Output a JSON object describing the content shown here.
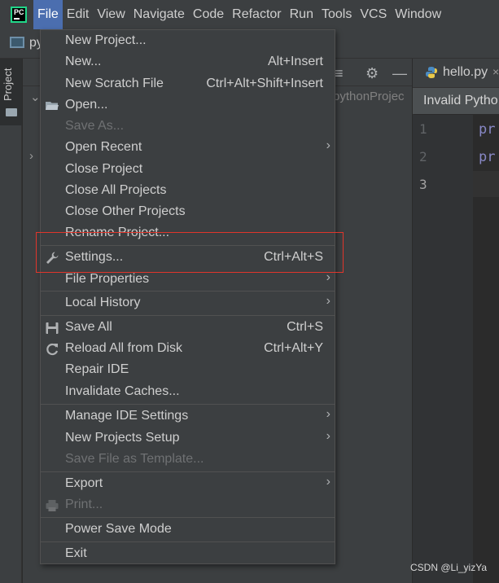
{
  "menubar": {
    "logo_text": "PC",
    "items": [
      "File",
      "Edit",
      "View",
      "Navigate",
      "Code",
      "Refactor",
      "Run",
      "Tools",
      "VCS",
      "Window"
    ],
    "active": "File"
  },
  "navbar": {
    "project_short": "py"
  },
  "stripe": {
    "project_label": "Project"
  },
  "project_panel": {
    "path_fragment": "pythonProjec"
  },
  "editor": {
    "tab_label": "hello.py",
    "notification": "Invalid Pytho",
    "line_numbers": [
      "1",
      "2",
      "3"
    ],
    "code_lines": [
      "pr",
      "pr"
    ]
  },
  "file_menu": {
    "items": [
      {
        "label": "New Project...",
        "shortcut": "",
        "disabled": false,
        "submenu": false,
        "icon": ""
      },
      {
        "label": "New...",
        "shortcut": "Alt+Insert",
        "disabled": false,
        "submenu": false,
        "icon": ""
      },
      {
        "label": "New Scratch File",
        "shortcut": "Ctrl+Alt+Shift+Insert",
        "disabled": false,
        "submenu": false,
        "icon": ""
      },
      {
        "label": "Open...",
        "shortcut": "",
        "disabled": false,
        "submenu": false,
        "icon": "folder-icon"
      },
      {
        "label": "Save As...",
        "shortcut": "",
        "disabled": true,
        "submenu": false,
        "icon": ""
      },
      {
        "label": "Open Recent",
        "shortcut": "",
        "disabled": false,
        "submenu": true,
        "icon": ""
      },
      {
        "label": "Close Project",
        "shortcut": "",
        "disabled": false,
        "submenu": false,
        "icon": ""
      },
      {
        "label": "Close All Projects",
        "shortcut": "",
        "disabled": false,
        "submenu": false,
        "icon": ""
      },
      {
        "label": "Close Other Projects",
        "shortcut": "",
        "disabled": false,
        "submenu": false,
        "icon": ""
      },
      {
        "label": "Rename Project...",
        "shortcut": "",
        "disabled": false,
        "submenu": false,
        "icon": ""
      },
      {
        "label": "Settings...",
        "shortcut": "Ctrl+Alt+S",
        "disabled": false,
        "submenu": false,
        "icon": "wrench-icon"
      },
      {
        "label": "File Properties",
        "shortcut": "",
        "disabled": false,
        "submenu": true,
        "icon": ""
      },
      {
        "label": "Local History",
        "shortcut": "",
        "disabled": false,
        "submenu": true,
        "icon": ""
      },
      {
        "label": "Save All",
        "shortcut": "Ctrl+S",
        "disabled": false,
        "submenu": false,
        "icon": "save-icon"
      },
      {
        "label": "Reload All from Disk",
        "shortcut": "Ctrl+Alt+Y",
        "disabled": false,
        "submenu": false,
        "icon": "reload-icon"
      },
      {
        "label": "Repair IDE",
        "shortcut": "",
        "disabled": false,
        "submenu": false,
        "icon": ""
      },
      {
        "label": "Invalidate Caches...",
        "shortcut": "",
        "disabled": false,
        "submenu": false,
        "icon": ""
      },
      {
        "label": "Manage IDE Settings",
        "shortcut": "",
        "disabled": false,
        "submenu": true,
        "icon": ""
      },
      {
        "label": "New Projects Setup",
        "shortcut": "",
        "disabled": false,
        "submenu": true,
        "icon": ""
      },
      {
        "label": "Save File as Template...",
        "shortcut": "",
        "disabled": true,
        "submenu": false,
        "icon": ""
      },
      {
        "label": "Export",
        "shortcut": "",
        "disabled": false,
        "submenu": true,
        "icon": ""
      },
      {
        "label": "Print...",
        "shortcut": "",
        "disabled": true,
        "submenu": false,
        "icon": "printer-icon"
      },
      {
        "label": "Power Save Mode",
        "shortcut": "",
        "disabled": false,
        "submenu": false,
        "icon": ""
      },
      {
        "label": "Exit",
        "shortcut": "",
        "disabled": false,
        "submenu": false,
        "icon": ""
      }
    ]
  },
  "watermark": "CSDN @Li_yizYa",
  "colors": {
    "menubar_bg": "#3c3f41",
    "active_menu": "#4b6eaf",
    "editor_bg": "#2b2b2b",
    "highlight_box": "#e0352b",
    "disabled_text": "#6f7173"
  }
}
